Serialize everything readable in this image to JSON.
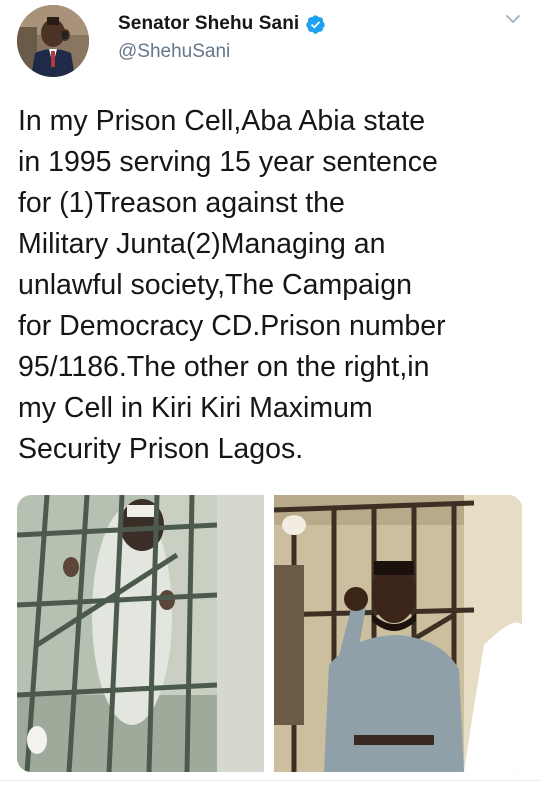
{
  "author": {
    "name": "Senator Shehu Sani",
    "handle": "@ShehuSani",
    "verified": true,
    "avatar_icon": "profile-photo-avatar"
  },
  "tweet": {
    "lines": [
      "In my Prison Cell,Aba Abia state",
      "in 1995 serving 15 year sentence",
      "for (1)Treason against the",
      "Military Junta(2)Managing an",
      "unlawful society,The Campaign",
      "for Democracy CD.Prison number",
      "95/1186.The other on the right,in",
      "my Cell in Kiri Kiri Maximum",
      "Security Prison Lagos."
    ]
  },
  "media": {
    "count": 2
  },
  "colors": {
    "name": "#14171a",
    "handle": "#657786",
    "verified_badge": "#1da1f2",
    "divider": "#e6ecf0"
  },
  "icons": {
    "verified": "verified-badge-icon",
    "menu": "chevron-down-icon"
  }
}
